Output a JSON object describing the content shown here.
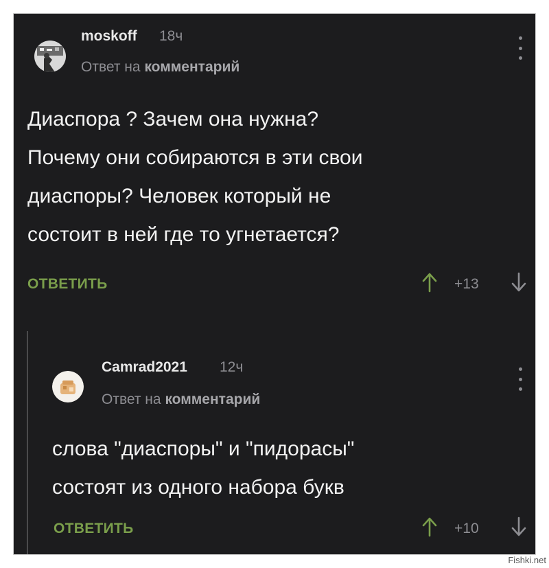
{
  "comments": [
    {
      "author": "moskoff",
      "time": "18ч",
      "reply_prefix": "Ответ на",
      "reply_target": "комментарий",
      "body": "Диаспора ? Зачем она нужна?\nПочему они собираются в эти свои\nдиаспоры? Человек который не\nсостоит в ней где то угнетается?",
      "reply_label": "ОТВЕТИТЬ",
      "score": "+13"
    },
    {
      "author": "Camrad2021",
      "time": "12ч",
      "reply_prefix": "Ответ на",
      "reply_target": "комментарий",
      "body": "слова \"диаспоры\" и \"пидорасы\"\nсостоят из одного набора букв",
      "reply_label": "ОТВЕТИТЬ",
      "score": "+10"
    }
  ],
  "watermark": "Fishki.net",
  "colors": {
    "background": "#1c1c1e",
    "reply_accent": "#7a9e4b",
    "text": "#f2f2f2",
    "muted": "#8d8d92"
  },
  "icons": {
    "vote_up": "arrow-up-icon",
    "vote_down": "arrow-down-icon",
    "more": "kebab-menu-icon"
  }
}
